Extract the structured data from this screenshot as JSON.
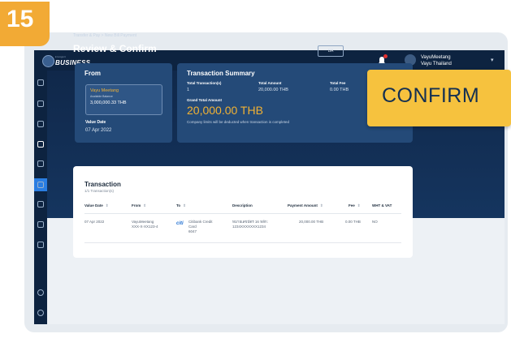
{
  "step_badge": "15",
  "callout": "CONFIRM",
  "brand": {
    "sub": "krungsri",
    "name": "BUSINESS"
  },
  "user": {
    "name": "VayuMeetang",
    "company": "Vayu Thailand"
  },
  "breadcrumb": "Transfer & Pay > New Bill Payment",
  "page_title": "Review & Confirm",
  "back_button": "BA",
  "from": {
    "heading": "From",
    "account_name": "Vayu Meetang",
    "balance_label": "Available Balance",
    "balance": "3,000,000.33 THB",
    "value_date_label": "Value Date",
    "value_date": "07 Apr 2022"
  },
  "summary": {
    "heading": "Transaction Summary",
    "count_label": "Total Transaction(s)",
    "count": "1",
    "amount_label": "Total Amount",
    "amount": "20,000.00 THB",
    "fee_label": "Total Fee",
    "fee": "0.00 THB",
    "grand_label": "Grand Total Amount",
    "grand": "20,000.00 THB",
    "note": "Company limits will be deducted when transaction is completed"
  },
  "transaction": {
    "heading": "Transaction",
    "sub": "1/1 Transaction(s)",
    "headers": {
      "value_date": "Value Date",
      "from": "From",
      "to": "To",
      "description": "Description",
      "payment_amount": "Payment Amount",
      "fee": "Fee",
      "wht": "WHT & VAT"
    },
    "row": {
      "value_date": "07 Apr 2022",
      "from_line1": "VayuMeetang",
      "from_line2": "XXX-X-XX123-4",
      "to_logo": "citi",
      "to_line1": "Citibank Credit",
      "to_line2": "Card",
      "to_line3": "6047",
      "desc_line1": "หมายเลขบัตร 16 หลัก:",
      "desc_line2": "1234XXXXXXX1234",
      "amount": "20,000.00 THB",
      "fee": "0.00 THB",
      "wht": "NO"
    }
  }
}
